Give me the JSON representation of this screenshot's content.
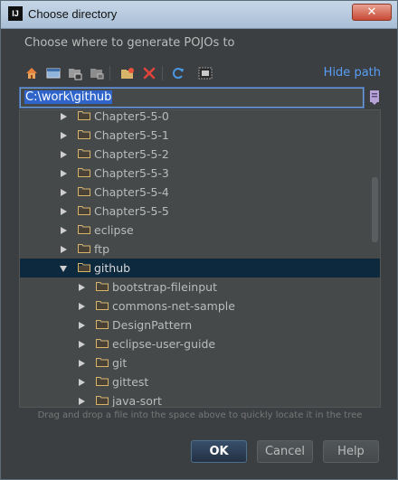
{
  "window": {
    "title": "Choose directory",
    "app_icon_text": "IJ",
    "close_symbol": "✕"
  },
  "prompt": "Choose where to generate POJOs to",
  "toolbar": {
    "icons": [
      "home-icon",
      "desktop-icon",
      "project-folder-icon",
      "module-folder-icon",
      "new-folder-icon",
      "delete-icon",
      "refresh-icon",
      "show-hidden-icon"
    ],
    "hide_path_label": "Hide path"
  },
  "path": {
    "value": "C:\\work\\github"
  },
  "tree": {
    "rows": [
      {
        "label": "Chapter5-5-0",
        "level": 1,
        "expanded": false,
        "selected": false
      },
      {
        "label": "Chapter5-5-1",
        "level": 1,
        "expanded": false,
        "selected": false
      },
      {
        "label": "Chapter5-5-2",
        "level": 1,
        "expanded": false,
        "selected": false
      },
      {
        "label": "Chapter5-5-3",
        "level": 1,
        "expanded": false,
        "selected": false
      },
      {
        "label": "Chapter5-5-4",
        "level": 1,
        "expanded": false,
        "selected": false
      },
      {
        "label": "Chapter5-5-5",
        "level": 1,
        "expanded": false,
        "selected": false
      },
      {
        "label": "eclipse",
        "level": 1,
        "expanded": false,
        "selected": false
      },
      {
        "label": "ftp",
        "level": 1,
        "expanded": false,
        "selected": false
      },
      {
        "label": "github",
        "level": 1,
        "expanded": true,
        "selected": true
      },
      {
        "label": "bootstrap-fileinput",
        "level": 2,
        "expanded": false,
        "selected": false
      },
      {
        "label": "commons-net-sample",
        "level": 2,
        "expanded": false,
        "selected": false
      },
      {
        "label": "DesignPattern",
        "level": 2,
        "expanded": false,
        "selected": false
      },
      {
        "label": "eclipse-user-guide",
        "level": 2,
        "expanded": false,
        "selected": false
      },
      {
        "label": "git",
        "level": 2,
        "expanded": false,
        "selected": false
      },
      {
        "label": "gittest",
        "level": 2,
        "expanded": false,
        "selected": false
      },
      {
        "label": "java-sort",
        "level": 2,
        "expanded": false,
        "selected": false
      }
    ]
  },
  "hint": "Drag and drop a file into the space above to quickly locate it in the tree",
  "buttons": {
    "ok": "OK",
    "cancel": "Cancel",
    "help": "Help"
  },
  "colors": {
    "background": "#3c3f41",
    "tree_background": "#45494a",
    "selection": "#0d293e",
    "link": "#589df6",
    "folder": "#d8b36a"
  }
}
